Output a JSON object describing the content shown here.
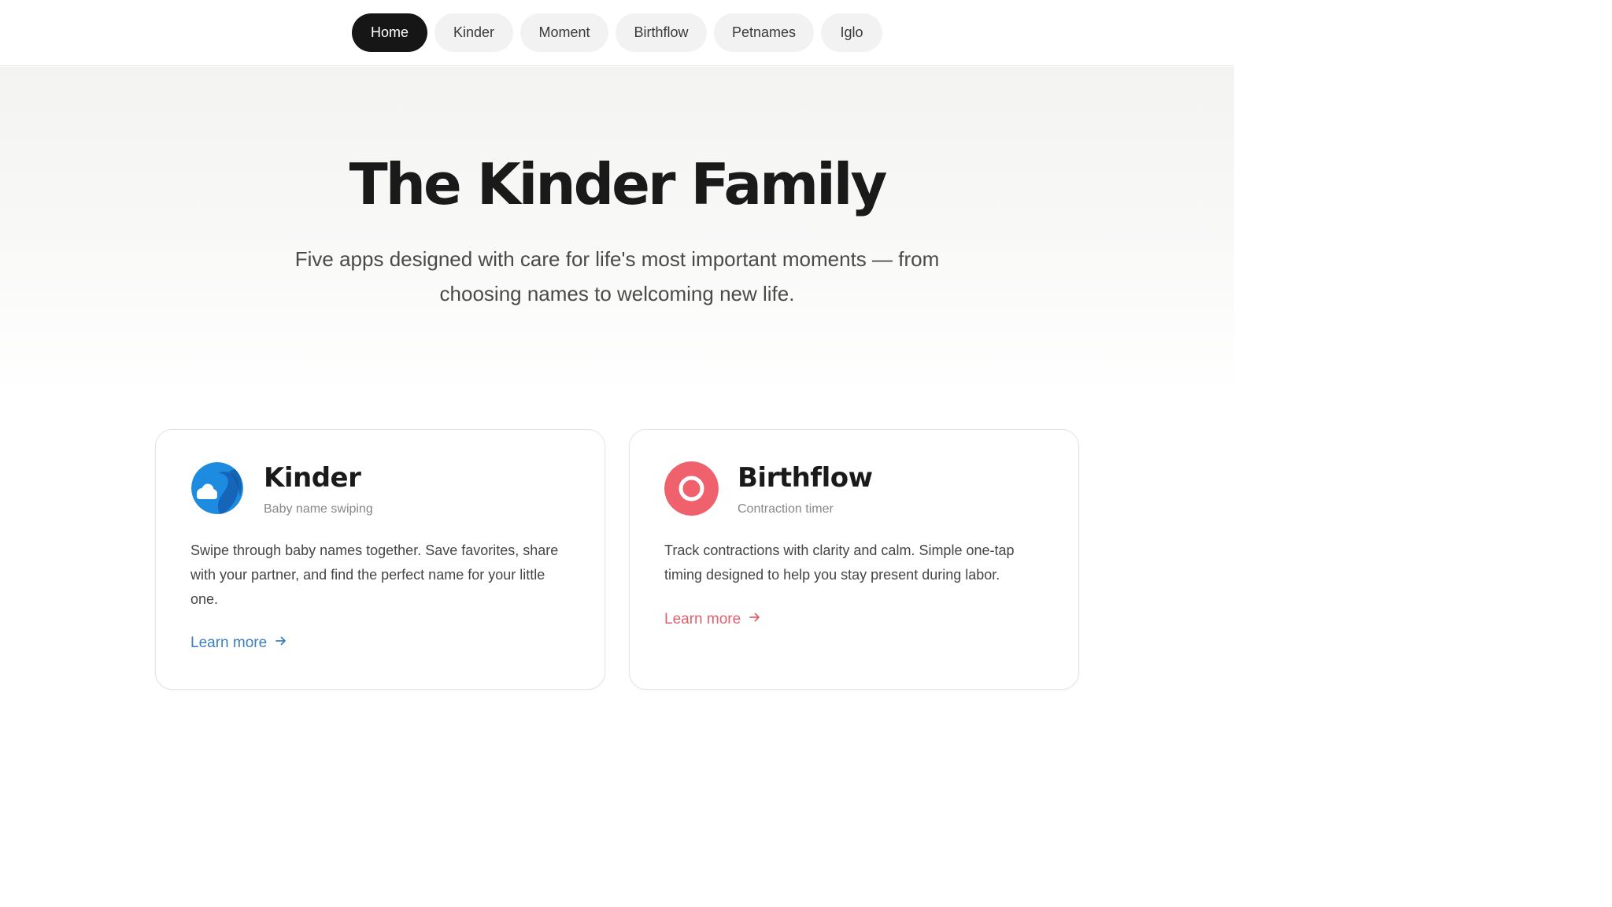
{
  "nav": {
    "items": [
      {
        "label": "Home",
        "active": true
      },
      {
        "label": "Kinder",
        "active": false
      },
      {
        "label": "Moment",
        "active": false
      },
      {
        "label": "Birthflow",
        "active": false
      },
      {
        "label": "Petnames",
        "active": false
      },
      {
        "label": "Iglo",
        "active": false
      }
    ]
  },
  "hero": {
    "title": "The Kinder Family",
    "subtitle": "Five apps designed with care for life's most important moments — from choosing names to welcoming new life."
  },
  "cards": [
    {
      "title": "Kinder",
      "subtitle": "Baby name swiping",
      "description": "Swipe through baby names together. Save favorites, share with your partner, and find the perfect name for your little one.",
      "link_label": "Learn more",
      "accent": "#3a7fc1",
      "icon": "kinder-app-icon"
    },
    {
      "title": "Birthflow",
      "subtitle": "Contraction timer",
      "description": "Track contractions with clarity and calm. Simple one-tap timing designed to help you stay present during labor.",
      "link_label": "Learn more",
      "accent": "#e2606c",
      "icon": "birthflow-app-icon"
    }
  ]
}
